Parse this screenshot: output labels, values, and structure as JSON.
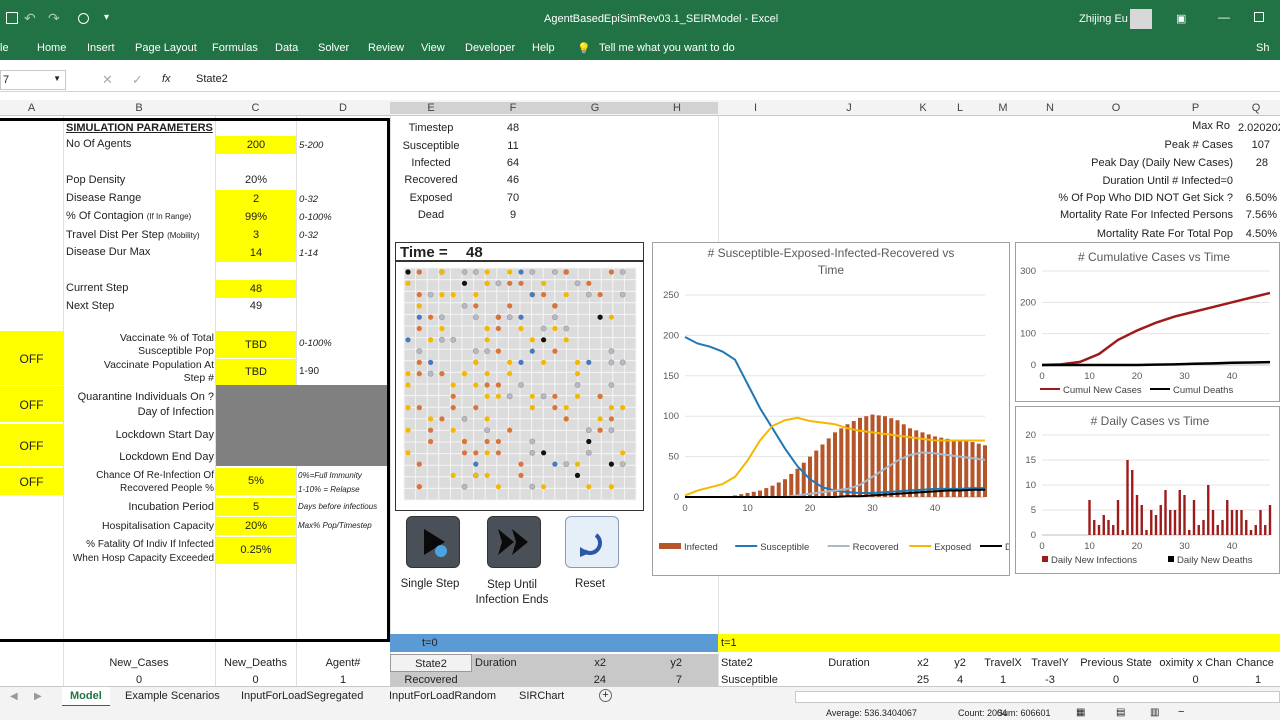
{
  "titlebar": {
    "title": "AgentBasedEpiSimRev03.1_SEIRModel - Excel",
    "user": "Zhijing Eu"
  },
  "ribbon": {
    "tabs": [
      "le",
      "Home",
      "Insert",
      "Page Layout",
      "Formulas",
      "Data",
      "Solver",
      "Review",
      "View",
      "Developer",
      "Help"
    ],
    "tell_me": "Tell me what you want to do",
    "share": "Sh"
  },
  "formula_bar": {
    "namebox": "7",
    "fx": "fx",
    "value": "State2"
  },
  "columns": [
    "A",
    "B",
    "C",
    "D",
    "E",
    "F",
    "G",
    "H",
    "I",
    "J",
    "K",
    "L",
    "M",
    "N",
    "O",
    "P",
    "Q"
  ],
  "params": {
    "title": "SIMULATION PARAMETERS",
    "rows": [
      {
        "label": "No Of Agents",
        "value": "200",
        "range": "5-200"
      },
      {
        "label": "Pop Density",
        "value": "20%",
        "range": ""
      },
      {
        "label": "Disease Range",
        "value": "2",
        "range": "0-32"
      },
      {
        "label": "% Of Contagion",
        "sub": "(If In Range)",
        "value": "99%",
        "range": "0-100%"
      },
      {
        "label": "Travel Dist Per Step",
        "sub": "(Mobility)",
        "value": "3",
        "range": "0-32"
      },
      {
        "label": "Disease Dur Max",
        "value": "14",
        "range": "1-14"
      },
      {
        "label": "Current Step",
        "value": "48",
        "range": ""
      },
      {
        "label": "Next Step",
        "value": "49",
        "range": ""
      }
    ],
    "vacc_label1": "Vaccinate % of Total Susceptible Pop",
    "vacc_value1": "TBD",
    "vacc_range1": "0-100%",
    "vacc_label2": "Vaccinate Population At Step #",
    "vacc_value2": "TBD",
    "vacc_range2": "1-90",
    "quarantine_label": "Quarantine Individuals On ? Day of Infection",
    "lockdown_start": "Lockdown Start Day",
    "lockdown_end": "Lockdown End Day",
    "reinfect_label": "Chance Of Re-Infection Of Recovered People %",
    "reinfect_value": "5%",
    "reinfect_note1": "0%=Full Immunity",
    "reinfect_note2": "1-10% = Relapse",
    "incubation_label": "Incubation Period",
    "incubation_value": "5",
    "incubation_note": "Days before infectious",
    "hosp_label": "Hospitalisation Capacity",
    "hosp_value": "20%",
    "hosp_note": "Max% Pop/Timestep",
    "fatality_label": "% Fatality Of Indiv If Infected When Hosp Capacity Exceeded",
    "fatality_value": "0.25%",
    "off": "OFF"
  },
  "stats": [
    {
      "label": "Timestep",
      "value": "48"
    },
    {
      "label": "Susceptible",
      "value": "11"
    },
    {
      "label": "Infected",
      "value": "64"
    },
    {
      "label": "Recovered",
      "value": "46"
    },
    {
      "label": "Exposed",
      "value": "70"
    },
    {
      "label": "Dead",
      "value": "9"
    }
  ],
  "summary": [
    {
      "label": "Max Ro",
      "value": "2.020202"
    },
    {
      "label": "Peak # Cases",
      "value": "107"
    },
    {
      "label": "Peak Day (Daily New Cases)",
      "value": "28"
    },
    {
      "label": "Duration Until # Infected=0",
      "value": ""
    },
    {
      "label": "% Of Pop Who DID NOT Get Sick ?",
      "value": "6.50%"
    },
    {
      "label": "Mortality Rate For Infected Persons",
      "value": "7.56%"
    },
    {
      "label": "Mortality Rate For Total Pop",
      "value": "4.50%"
    }
  ],
  "time_panel": {
    "label": "Time =",
    "value": "48"
  },
  "buttons": [
    {
      "label": "Single Step"
    },
    {
      "label": "Step Until Infection Ends"
    },
    {
      "label": "Reset"
    }
  ],
  "bottom": {
    "t0": "t=0",
    "t1": "t=1",
    "headers_left": [
      "New_Cases",
      "New_Deaths",
      "Agent#"
    ],
    "values_left": [
      "0",
      "0",
      "1"
    ],
    "headers_mid": [
      "State2",
      "Duration",
      "x2",
      "y2"
    ],
    "values_mid": [
      "Recovered",
      "",
      "24",
      "7"
    ],
    "headers_right": [
      "State2",
      "Duration",
      "x2",
      "y2",
      "TravelX",
      "TravelY",
      "Previous State",
      "oximity x Chan",
      "Chance"
    ],
    "values_right": [
      "Susceptible",
      "",
      "25",
      "4",
      "1",
      "-3",
      "0",
      "0",
      "1"
    ]
  },
  "sheet_tabs": [
    "Model",
    "Example Scenarios",
    "InputForLoadSegregated",
    "InputForLoadRandom",
    "SIRChart"
  ],
  "status": {
    "average": "Average: 536.3404067",
    "count": "Count: 2004",
    "sum": "Sum: 606601"
  },
  "chart_data": [
    {
      "type": "line",
      "title": "# Susceptible-Exposed-Infected-Recovered  vs Time",
      "xlim": [
        0,
        48
      ],
      "ylim": [
        0,
        250
      ],
      "xticks": [
        0,
        10,
        20,
        30,
        40
      ],
      "yticks": [
        0,
        50,
        100,
        150,
        200,
        250
      ],
      "x": [
        0,
        2,
        4,
        6,
        8,
        10,
        12,
        14,
        16,
        18,
        20,
        22,
        24,
        26,
        28,
        30,
        32,
        34,
        36,
        38,
        40,
        42,
        44,
        46,
        48
      ],
      "series": [
        {
          "name": "Infected",
          "kind": "bar",
          "color": "#b5562a",
          "values": [
            0,
            0,
            0,
            0,
            2,
            5,
            8,
            14,
            22,
            35,
            50,
            65,
            80,
            90,
            98,
            102,
            100,
            95,
            85,
            80,
            75,
            72,
            70,
            68,
            64
          ]
        },
        {
          "name": "Susceptible",
          "color": "#1f77b4",
          "values": [
            198,
            190,
            186,
            180,
            170,
            140,
            110,
            85,
            60,
            38,
            22,
            12,
            8,
            6,
            5,
            5,
            6,
            7,
            8,
            9,
            10,
            10,
            10,
            11,
            11
          ]
        },
        {
          "name": "Recovered",
          "color": "#a9b7c9",
          "values": [
            0,
            0,
            0,
            0,
            0,
            0,
            0,
            0,
            0,
            2,
            4,
            6,
            8,
            10,
            15,
            25,
            35,
            45,
            52,
            55,
            54,
            52,
            50,
            48,
            46
          ]
        },
        {
          "name": "Exposed",
          "color": "#f5b800",
          "values": [
            2,
            8,
            12,
            16,
            25,
            45,
            70,
            88,
            95,
            98,
            94,
            92,
            90,
            85,
            82,
            80,
            78,
            76,
            74,
            72,
            70,
            70,
            70,
            70,
            70
          ]
        },
        {
          "name": "Dead",
          "color": "#000000",
          "values": [
            0,
            0,
            0,
            0,
            0,
            0,
            0,
            0,
            0,
            0,
            0,
            0,
            0,
            1,
            1,
            2,
            3,
            4,
            5,
            6,
            7,
            8,
            8,
            9,
            9
          ]
        }
      ]
    },
    {
      "type": "line",
      "title": "# Cumulative Cases vs Time",
      "xlim": [
        0,
        48
      ],
      "ylim": [
        0,
        300
      ],
      "xticks": [
        0,
        10,
        20,
        30,
        40
      ],
      "yticks": [
        0,
        100,
        200,
        300
      ],
      "x": [
        0,
        4,
        8,
        12,
        16,
        20,
        24,
        28,
        32,
        36,
        40,
        44,
        48
      ],
      "series": [
        {
          "name": "Cumul New Cases",
          "color": "#9e1b1b",
          "values": [
            0,
            2,
            10,
            35,
            80,
            110,
            135,
            155,
            170,
            185,
            200,
            215,
            230
          ]
        },
        {
          "name": "Cumul Deaths",
          "color": "#000000",
          "values": [
            0,
            0,
            0,
            0,
            0,
            0,
            1,
            2,
            4,
            5,
            7,
            8,
            9
          ]
        }
      ]
    },
    {
      "type": "bar",
      "title": "# Daily Cases vs Time",
      "xlim": [
        0,
        48
      ],
      "ylim": [
        0,
        20
      ],
      "xticks": [
        0,
        10,
        20,
        30,
        40
      ],
      "yticks": [
        0,
        5,
        10,
        15,
        20
      ],
      "series": [
        {
          "name": "Daily New Infections",
          "color": "#9e1b1b",
          "values": [
            0,
            0,
            0,
            0,
            0,
            0,
            0,
            0,
            0,
            0,
            7,
            3,
            2,
            4,
            3,
            2,
            7,
            1,
            15,
            13,
            8,
            6,
            1,
            5,
            4,
            6,
            9,
            5,
            5,
            9,
            8,
            1,
            7,
            2,
            3,
            10,
            5,
            2,
            3,
            7,
            5,
            5,
            5,
            3,
            1,
            2,
            5,
            2,
            6
          ]
        },
        {
          "name": "Daily New Deaths",
          "color": "#000000",
          "values": []
        }
      ]
    }
  ]
}
